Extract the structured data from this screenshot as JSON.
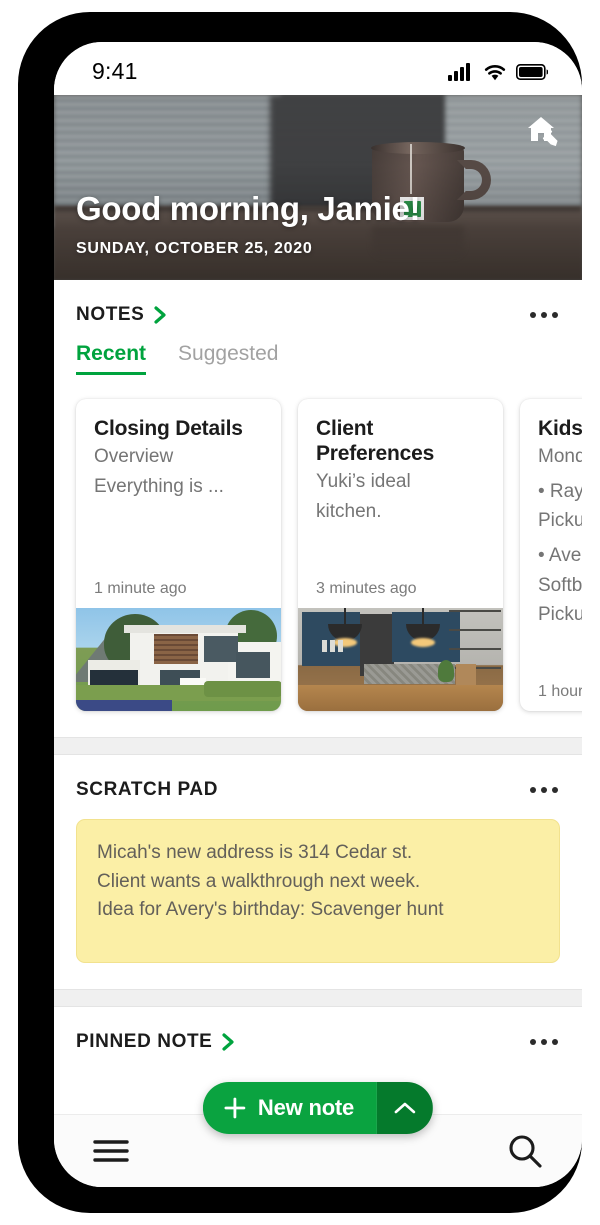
{
  "status_bar": {
    "time": "9:41",
    "icons": [
      "cellular-signal-icon",
      "wifi-icon",
      "battery-icon"
    ]
  },
  "hero": {
    "greeting": "Good morning, Jamie!",
    "date": "SUNDAY, OCTOBER 25, 2020",
    "action_icon": "home-edit-icon",
    "photo_description": "coffee mug with tea bag on desk"
  },
  "notes_section": {
    "title": "NOTES",
    "chevron_icon": "chevron-right-icon",
    "menu_icon": "overflow-menu-icon",
    "tabs": [
      {
        "label": "Recent",
        "active": true
      },
      {
        "label": "Suggested",
        "active": false
      }
    ],
    "cards": [
      {
        "title": "Closing Details",
        "lines": [
          "Overview",
          "Everything is ..."
        ],
        "time": "1 minute ago",
        "thumb": "modern-house-photo"
      },
      {
        "title": "Client Preferences",
        "lines": [
          "Yuki’s ideal",
          "kitchen."
        ],
        "time": "3 minutes ago",
        "thumb": "blue-kitchen-photo"
      },
      {
        "title": "Kids’",
        "lines": [
          "Mond",
          "• Ray -",
          "Pickup",
          "• Aver",
          "Softba",
          "Pickup"
        ],
        "time": "1 hour",
        "thumb": "none"
      }
    ]
  },
  "scratch_pad": {
    "title": "SCRATCH PAD",
    "menu_icon": "overflow-menu-icon",
    "lines": [
      "Micah's new address is 314 Cedar st.",
      "Client wants a walkthrough next week.",
      "Idea for Avery's birthday: Scavenger hunt"
    ]
  },
  "pinned_note": {
    "title": "PINNED NOTE",
    "chevron_icon": "chevron-right-icon",
    "menu_icon": "overflow-menu-icon"
  },
  "fab": {
    "label": "New note",
    "plus_icon": "plus-icon",
    "caret_icon": "chevron-up-icon"
  },
  "bottom_bar": {
    "menu_icon": "hamburger-menu-icon",
    "search_icon": "search-icon"
  },
  "colors": {
    "accent_green": "#00a33e",
    "fab_green": "#0aa340",
    "fab_green_dark": "#057a2c",
    "scratch_yellow": "#fbefa6",
    "muted_text": "#757575"
  }
}
